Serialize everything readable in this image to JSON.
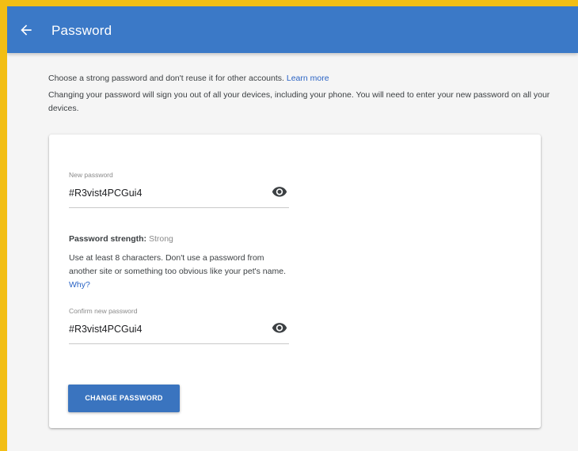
{
  "header": {
    "title": "Password",
    "back_icon": "arrow-left-icon",
    "color": "#3b79c7"
  },
  "intro": {
    "line1": "Choose a strong password and don't reuse it for other accounts.",
    "learn_more": "Learn more",
    "line2": "Changing your password will sign you out of all your devices, including your phone. You will need to enter your new password on all your devices."
  },
  "form": {
    "new_password": {
      "label": "New password",
      "value": "#R3vist4PCGui4",
      "visibility_icon": "eye-icon"
    },
    "strength": {
      "label": "Password strength:",
      "value": "Strong"
    },
    "hint": {
      "text": "Use at least 8 characters. Don't use a password from another site or something too obvious like your pet's name.",
      "why_link": "Why?"
    },
    "confirm_password": {
      "label": "Confirm new password",
      "value": "#R3vist4PCGui4",
      "visibility_icon": "eye-icon"
    },
    "submit_label": "CHANGE PASSWORD"
  },
  "colors": {
    "accent": "#3a74bf",
    "link": "#2a63c4",
    "outer_border": "#f2be14"
  }
}
